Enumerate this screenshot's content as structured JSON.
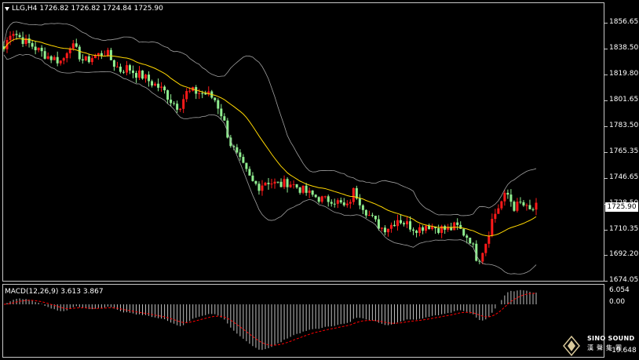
{
  "header": {
    "symbol": "LLG,H4",
    "ohlc": "1726.82 1726.82 1724.84 1725.90"
  },
  "price_axis": {
    "labels": [
      "1856.65",
      "1838.50",
      "1819.80",
      "1801.65",
      "1783.50",
      "1765.35",
      "1746.65",
      "1728.50",
      "1710.35",
      "1692.20",
      "1674.05"
    ],
    "current": "1725.90"
  },
  "macd": {
    "label": "MACD(12,26,9) 3.613 3.867",
    "axis_labels": [
      "6.054",
      "0.00",
      "-19.648"
    ]
  },
  "logo": {
    "name": "SINO SOUND",
    "chinese": "漢聲集團"
  },
  "colors": {
    "up": "#ff1a1a",
    "down": "#90ee90",
    "ma": "#ffd700",
    "bands": "#a0a0a0",
    "macd_bars": "#c0c0c0",
    "signal": "#ff0000"
  },
  "chart_data": {
    "type": "candlestick",
    "timeframe": "H4",
    "ylim": [
      1674.05,
      1856.65
    ],
    "close_path": [
      1838,
      1852,
      1847,
      1843,
      1840,
      1836,
      1833,
      1831,
      1829,
      1842,
      1836,
      1829,
      1832,
      1834,
      1836,
      1828,
      1823,
      1825,
      1821,
      1819,
      1815,
      1812,
      1808,
      1801,
      1797,
      1807,
      1808,
      1807,
      1806,
      1802,
      1790,
      1772,
      1762,
      1753,
      1744,
      1741,
      1745,
      1743,
      1742,
      1744,
      1741,
      1738,
      1735,
      1733,
      1731,
      1732,
      1729,
      1725,
      1738,
      1729,
      1721,
      1715,
      1711,
      1713,
      1718,
      1715,
      1712,
      1711,
      1714,
      1712,
      1711,
      1710,
      1713,
      1708,
      1703,
      1688,
      1700,
      1718,
      1728,
      1736,
      1726,
      1729,
      1723,
      1726
    ],
    "macd_range": [
      -19.648,
      6.054
    ]
  }
}
